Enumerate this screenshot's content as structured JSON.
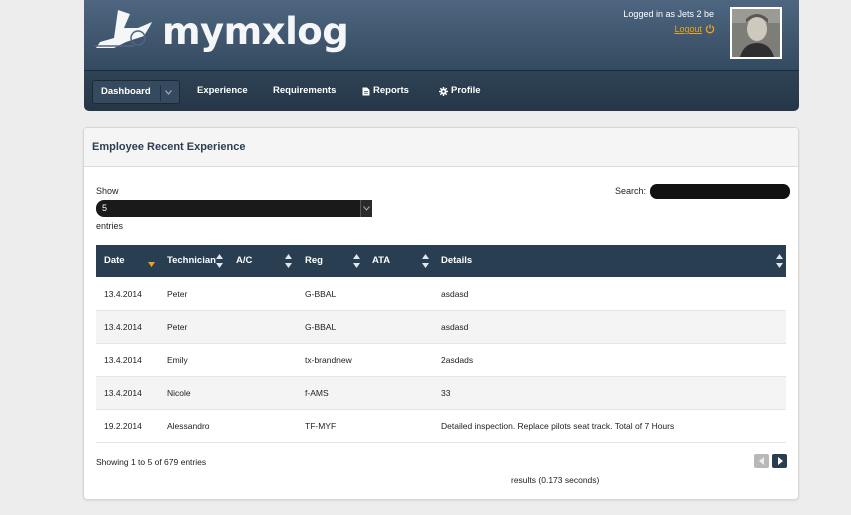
{
  "app": {
    "brand": "mymxlog",
    "logged_in_text": "Logged in as Jets 2 be",
    "logout_label": "Logout"
  },
  "nav": {
    "items": [
      {
        "label": "Dashboard"
      },
      {
        "label": "Experience"
      },
      {
        "label": "Requirements"
      },
      {
        "label": "Reports"
      },
      {
        "label": "Profile"
      }
    ]
  },
  "panel": {
    "title": "Employee Recent Experience",
    "show_label": "Show",
    "show_value": "5",
    "entries_label": "entries",
    "search_label": "Search:",
    "search_value": ""
  },
  "table": {
    "columns": [
      "Date",
      "Technician",
      "A/C",
      "Reg",
      "ATA",
      "Details"
    ],
    "rows": [
      {
        "date": "13.4.2014",
        "technician": "Peter",
        "ac": "",
        "reg": "G-BBAL",
        "ata": "",
        "details": "asdasd"
      },
      {
        "date": "13.4.2014",
        "technician": "Peter",
        "ac": "",
        "reg": "G-BBAL",
        "ata": "",
        "details": "asdasd"
      },
      {
        "date": "13.4.2014",
        "technician": "Emily",
        "ac": "",
        "reg": "tx-brandnew",
        "ata": "",
        "details": "2asdads"
      },
      {
        "date": "13.4.2014",
        "technician": "Nicole",
        "ac": "",
        "reg": "f-AMS",
        "ata": "",
        "details": "33"
      },
      {
        "date": "19.2.2014",
        "technician": "Alessandro",
        "ac": "",
        "reg": "TF-MYF",
        "ata": "",
        "details": "Detailed inspection. Replace pilots seat track. Total of 7 Hours"
      }
    ],
    "info": "Showing 1 to 5 of 679 entries",
    "results": "results (0.173 seconds)"
  },
  "colors": {
    "header_bg": "#3f5670",
    "nav_bg": "#2a3e52",
    "table_head_bg": "#2a3e52",
    "accent": "#f0a21c"
  },
  "icons": {
    "logout": "power-icon",
    "reports": "document-icon",
    "profile": "gear-icon",
    "dropdown": "chevron-down-icon"
  }
}
